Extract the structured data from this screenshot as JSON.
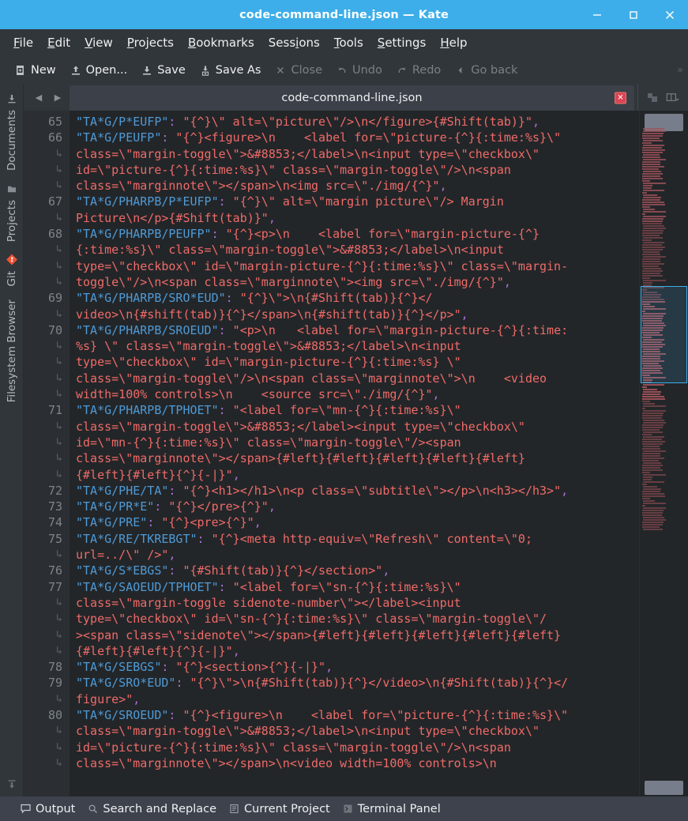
{
  "window": {
    "title": "code-command-line.json — Kate",
    "controls": [
      {
        "name": "minimize",
        "glyph": "—"
      },
      {
        "name": "maximize",
        "glyph": "□"
      },
      {
        "name": "close",
        "glyph": "✕"
      }
    ]
  },
  "menubar": {
    "items": [
      {
        "label": "File",
        "accel": "F"
      },
      {
        "label": "Edit",
        "accel": "E"
      },
      {
        "label": "View",
        "accel": "V"
      },
      {
        "label": "Projects",
        "accel": "P"
      },
      {
        "label": "Bookmarks",
        "accel": "B"
      },
      {
        "label": "Sessions",
        "accel": "i"
      },
      {
        "label": "Tools",
        "accel": "T"
      },
      {
        "label": "Settings",
        "accel": "S"
      },
      {
        "label": "Help",
        "accel": "H"
      }
    ]
  },
  "toolbar": {
    "buttons": [
      {
        "label": "New",
        "icon": "new-document-icon",
        "disabled": false
      },
      {
        "label": "Open...",
        "icon": "open-folder-icon",
        "disabled": false
      },
      {
        "label": "Save",
        "icon": "save-disk-icon",
        "disabled": false
      },
      {
        "label": "Save As",
        "icon": "save-as-icon",
        "disabled": false
      },
      {
        "label": "Close",
        "icon": "close-x-icon",
        "disabled": true
      },
      {
        "label": "Undo",
        "icon": "undo-arrow-icon",
        "disabled": true
      },
      {
        "label": "Redo",
        "icon": "redo-arrow-icon",
        "disabled": true
      },
      {
        "label": "Go back",
        "icon": "back-arrow-icon",
        "disabled": true
      }
    ],
    "overflow": "»"
  },
  "sidebar": {
    "items": [
      {
        "label": "Documents",
        "icon": "documents-icon"
      },
      {
        "label": "Projects",
        "icon": "projects-folder-icon"
      },
      {
        "label": "Git",
        "icon": "git-icon"
      },
      {
        "label": "Filesystem Browser",
        "icon": "filesystem-icon"
      }
    ],
    "bottom_icon": "collapse-icon"
  },
  "tabbar": {
    "prev_glyph": "◀",
    "next_glyph": "▶",
    "active_tab": "code-command-line.json",
    "close_glyph": "✕",
    "tools": [
      {
        "name": "split-view-icon"
      },
      {
        "name": "split-columns-dropdown-icon"
      }
    ]
  },
  "statusbar": {
    "items": [
      {
        "label": "Output",
        "icon": "output-console-icon"
      },
      {
        "label": "Search and Replace",
        "icon": "search-icon"
      },
      {
        "label": "Current Project",
        "icon": "project-icon"
      },
      {
        "label": "Terminal Panel",
        "icon": "terminal-icon"
      }
    ]
  },
  "colors": {
    "titlebar": "#3daee9",
    "chrome": "#31363b",
    "editor_bg": "#232629",
    "gutter_bg": "#2b2f33",
    "json_key": "#4e9ad6",
    "json_string": "#ef6b68",
    "json_punct": "#a96fd4",
    "line_number": "#7d848a",
    "close_badge": "#da4453",
    "status_bg": "#3d424d"
  },
  "editor": {
    "wrap_marker": "↳",
    "lines": [
      {
        "num": "65",
        "wrapped": false,
        "tokens": [
          {
            "t": "k",
            "v": "\"TA*G/P*EUFP\""
          },
          {
            "t": "p",
            "v": ":"
          },
          {
            "t": "s",
            "v": " \"{^}\\\" alt=\\\"picture\\\"/>\\n</figure>{#Shift(tab)}\""
          },
          {
            "t": "p",
            "v": ","
          }
        ]
      },
      {
        "num": "66",
        "wrapped": false,
        "tokens": [
          {
            "t": "k",
            "v": "\"TA*G/PEUFP\""
          },
          {
            "t": "p",
            "v": ":"
          },
          {
            "t": "s",
            "v": " \"{^}<figure>\\n    <label for=\\\"picture-{^}{:time:%s}\\\""
          }
        ]
      },
      {
        "num": "",
        "wrapped": true,
        "tokens": [
          {
            "t": "s",
            "v": "class=\\\"margin-toggle\\\">&#8853;</label>\\n<input type=\\\"checkbox\\\""
          }
        ]
      },
      {
        "num": "",
        "wrapped": true,
        "tokens": [
          {
            "t": "s",
            "v": "id=\\\"picture-{^}{:time:%s}\\\" class=\\\"margin-toggle\\\"/>\\n<span"
          }
        ]
      },
      {
        "num": "",
        "wrapped": true,
        "tokens": [
          {
            "t": "s",
            "v": "class=\\\"marginnote\\\"></span>\\n<img src=\\\"./img/{^}\""
          },
          {
            "t": "p",
            "v": ","
          }
        ]
      },
      {
        "num": "67",
        "wrapped": false,
        "tokens": [
          {
            "t": "k",
            "v": "\"TA*G/PHARPB/P*EUFP\""
          },
          {
            "t": "p",
            "v": ":"
          },
          {
            "t": "s",
            "v": " \"{^}\\\" alt=\\\"margin picture\\\"/> Margin"
          }
        ]
      },
      {
        "num": "",
        "wrapped": true,
        "tokens": [
          {
            "t": "s",
            "v": "Picture\\n</p>{#Shift(tab)}\""
          },
          {
            "t": "p",
            "v": ","
          }
        ]
      },
      {
        "num": "68",
        "wrapped": false,
        "tokens": [
          {
            "t": "k",
            "v": "\"TA*G/PHARPB/PEUFP\""
          },
          {
            "t": "p",
            "v": ":"
          },
          {
            "t": "s",
            "v": " \"{^}<p>\\n    <label for=\\\"margin-picture-{^}"
          }
        ]
      },
      {
        "num": "",
        "wrapped": true,
        "tokens": [
          {
            "t": "s",
            "v": "{:time:%s}\\\" class=\\\"margin-toggle\\\">&#8853;</label>\\n<input"
          }
        ]
      },
      {
        "num": "",
        "wrapped": true,
        "tokens": [
          {
            "t": "s",
            "v": "type=\\\"checkbox\\\" id=\\\"margin-picture-{^}{:time:%s}\\\" class=\\\"margin-"
          }
        ]
      },
      {
        "num": "",
        "wrapped": true,
        "tokens": [
          {
            "t": "s",
            "v": "toggle\\\"/>\\n<span class=\\\"marginnote\\\"><img src=\\\"./img/{^}\""
          },
          {
            "t": "p",
            "v": ","
          }
        ]
      },
      {
        "num": "69",
        "wrapped": false,
        "tokens": [
          {
            "t": "k",
            "v": "\"TA*G/PHARPB/SRO*EUD\""
          },
          {
            "t": "p",
            "v": ":"
          },
          {
            "t": "s",
            "v": " \"{^}\\\">\\n{#Shift(tab)}{^}</"
          }
        ]
      },
      {
        "num": "",
        "wrapped": true,
        "tokens": [
          {
            "t": "s",
            "v": "video>\\n{#shift(tab)}{^}</span>\\n{#shift(tab)}{^}</p>\""
          },
          {
            "t": "p",
            "v": ","
          }
        ]
      },
      {
        "num": "70",
        "wrapped": false,
        "tokens": [
          {
            "t": "k",
            "v": "\"TA*G/PHARPB/SROEUD\""
          },
          {
            "t": "p",
            "v": ":"
          },
          {
            "t": "s",
            "v": " \"<p>\\n   <label for=\\\"margin-picture-{^}{:time:"
          }
        ]
      },
      {
        "num": "",
        "wrapped": true,
        "tokens": [
          {
            "t": "s",
            "v": "%s} \\\" class=\\\"margin-toggle\\\">&#8853;</label>\\n<input"
          }
        ]
      },
      {
        "num": "",
        "wrapped": true,
        "tokens": [
          {
            "t": "s",
            "v": "type=\\\"checkbox\\\" id=\\\"margin-picture-{^}{:time:%s} \\\""
          }
        ]
      },
      {
        "num": "",
        "wrapped": true,
        "tokens": [
          {
            "t": "s",
            "v": "class=\\\"margin-toggle\\\"/>\\n<span class=\\\"marginnote\\\">\\n    <video"
          }
        ]
      },
      {
        "num": "",
        "wrapped": true,
        "tokens": [
          {
            "t": "s",
            "v": "width=100% controls>\\n    <source src=\\\"./img/{^}\""
          },
          {
            "t": "p",
            "v": ","
          }
        ]
      },
      {
        "num": "71",
        "wrapped": false,
        "tokens": [
          {
            "t": "k",
            "v": "\"TA*G/PHARPB/TPHOET\""
          },
          {
            "t": "p",
            "v": ":"
          },
          {
            "t": "s",
            "v": " \"<label for=\\\"mn-{^}{:time:%s}\\\""
          }
        ]
      },
      {
        "num": "",
        "wrapped": true,
        "tokens": [
          {
            "t": "s",
            "v": "class=\\\"margin-toggle\\\">&#8853;</label><input type=\\\"checkbox\\\""
          }
        ]
      },
      {
        "num": "",
        "wrapped": true,
        "tokens": [
          {
            "t": "s",
            "v": "id=\\\"mn-{^}{:time:%s}\\\" class=\\\"margin-toggle\\\"/><span"
          }
        ]
      },
      {
        "num": "",
        "wrapped": true,
        "tokens": [
          {
            "t": "s",
            "v": "class=\\\"marginnote\\\"></span>{#left}{#left}{#left}{#left}{#left}"
          }
        ]
      },
      {
        "num": "",
        "wrapped": true,
        "tokens": [
          {
            "t": "s",
            "v": "{#left}{#left}{^}{-|}\""
          },
          {
            "t": "p",
            "v": ","
          }
        ]
      },
      {
        "num": "72",
        "wrapped": false,
        "tokens": [
          {
            "t": "k",
            "v": "\"TA*G/PHE/TA\""
          },
          {
            "t": "p",
            "v": ":"
          },
          {
            "t": "s",
            "v": " \"{^}<h1></h1>\\n<p class=\\\"subtitle\\\"></p>\\n<h3></h3>\""
          },
          {
            "t": "p",
            "v": ","
          }
        ]
      },
      {
        "num": "73",
        "wrapped": false,
        "tokens": [
          {
            "t": "k",
            "v": "\"TA*G/PR*E\""
          },
          {
            "t": "p",
            "v": ":"
          },
          {
            "t": "s",
            "v": " \"{^}</pre>{^}\""
          },
          {
            "t": "p",
            "v": ","
          }
        ]
      },
      {
        "num": "74",
        "wrapped": false,
        "tokens": [
          {
            "t": "k",
            "v": "\"TA*G/PRE\""
          },
          {
            "t": "p",
            "v": ":"
          },
          {
            "t": "s",
            "v": " \"{^}<pre>{^}\""
          },
          {
            "t": "p",
            "v": ","
          }
        ]
      },
      {
        "num": "75",
        "wrapped": false,
        "tokens": [
          {
            "t": "k",
            "v": "\"TA*G/RE/TKREBGT\""
          },
          {
            "t": "p",
            "v": ":"
          },
          {
            "t": "s",
            "v": " \"{^}<meta http-equiv=\\\"Refresh\\\" content=\\\"0;"
          }
        ]
      },
      {
        "num": "",
        "wrapped": true,
        "tokens": [
          {
            "t": "s",
            "v": "url=../\\\" />\""
          },
          {
            "t": "p",
            "v": ","
          }
        ]
      },
      {
        "num": "76",
        "wrapped": false,
        "tokens": [
          {
            "t": "k",
            "v": "\"TA*G/S*EBGS\""
          },
          {
            "t": "p",
            "v": ":"
          },
          {
            "t": "s",
            "v": " \"{#Shift(tab)}{^}</section>\""
          },
          {
            "t": "p",
            "v": ","
          }
        ]
      },
      {
        "num": "77",
        "wrapped": false,
        "tokens": [
          {
            "t": "k",
            "v": "\"TA*G/SAOEUD/TPHOET\""
          },
          {
            "t": "p",
            "v": ":"
          },
          {
            "t": "s",
            "v": " \"<label for=\\\"sn-{^}{:time:%s}\\\""
          }
        ]
      },
      {
        "num": "",
        "wrapped": true,
        "tokens": [
          {
            "t": "s",
            "v": "class=\\\"margin-toggle sidenote-number\\\"></label><input"
          }
        ]
      },
      {
        "num": "",
        "wrapped": true,
        "tokens": [
          {
            "t": "s",
            "v": "type=\\\"checkbox\\\" id=\\\"sn-{^}{:time:%s}\\\" class=\\\"margin-toggle\\\"/"
          }
        ]
      },
      {
        "num": "",
        "wrapped": true,
        "tokens": [
          {
            "t": "s",
            "v": "><span class=\\\"sidenote\\\"></span>{#left}{#left}{#left}{#left}{#left}"
          }
        ]
      },
      {
        "num": "",
        "wrapped": true,
        "tokens": [
          {
            "t": "s",
            "v": "{#left}{#left}{^}{-|}\""
          },
          {
            "t": "p",
            "v": ","
          }
        ]
      },
      {
        "num": "78",
        "wrapped": false,
        "tokens": [
          {
            "t": "k",
            "v": "\"TA*G/SEBGS\""
          },
          {
            "t": "p",
            "v": ":"
          },
          {
            "t": "s",
            "v": " \"{^}<section>{^}{-|}\""
          },
          {
            "t": "p",
            "v": ","
          }
        ]
      },
      {
        "num": "79",
        "wrapped": false,
        "tokens": [
          {
            "t": "k",
            "v": "\"TA*G/SRO*EUD\""
          },
          {
            "t": "p",
            "v": ":"
          },
          {
            "t": "s",
            "v": " \"{^}\\\">\\n{#Shift(tab)}{^}</video>\\n{#Shift(tab)}{^}</"
          }
        ]
      },
      {
        "num": "",
        "wrapped": true,
        "tokens": [
          {
            "t": "s",
            "v": "figure>\""
          },
          {
            "t": "p",
            "v": ","
          }
        ]
      },
      {
        "num": "80",
        "wrapped": false,
        "tokens": [
          {
            "t": "k",
            "v": "\"TA*G/SROEUD\""
          },
          {
            "t": "p",
            "v": ":"
          },
          {
            "t": "s",
            "v": " \"{^}<figure>\\n    <label for=\\\"picture-{^}{:time:%s}\\\""
          }
        ]
      },
      {
        "num": "",
        "wrapped": true,
        "tokens": [
          {
            "t": "s",
            "v": "class=\\\"margin-toggle\\\">&#8853;</label>\\n<input type=\\\"checkbox\\\""
          }
        ]
      },
      {
        "num": "",
        "wrapped": true,
        "tokens": [
          {
            "t": "s",
            "v": "id=\\\"picture-{^}{:time:%s}\\\" class=\\\"margin-toggle\\\"/>\\n<span"
          }
        ]
      },
      {
        "num": "",
        "wrapped": true,
        "tokens": [
          {
            "t": "s",
            "v": "class=\\\"marginnote\\\"></span>\\n<video width=100% controls>\\n"
          }
        ]
      }
    ]
  }
}
